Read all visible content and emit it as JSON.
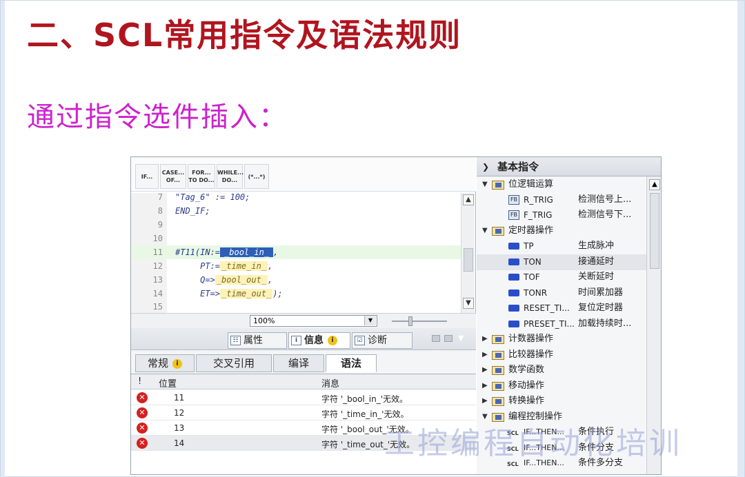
{
  "slide": {
    "title": "二、SCL常用指令及语法规则",
    "subtitle": "通过指令选件插入：",
    "watermark": "工控编程自动化培训"
  },
  "editor": {
    "toolbar": [
      {
        "label": "IF..."
      },
      {
        "label": "CASE...\nOF..."
      },
      {
        "label": "FOR...\nTO DO..."
      },
      {
        "label": "WHILE...\nDO..."
      },
      {
        "label": "(*...*)"
      }
    ],
    "lines": [
      {
        "num": "7",
        "text": "\"Tag_6\" := 100;"
      },
      {
        "num": "8",
        "text": "END_IF;"
      },
      {
        "num": "9",
        "text": ""
      },
      {
        "num": "10",
        "text": ""
      },
      {
        "num": "11",
        "prefix": "#T11(IN:=",
        "param": "_bool_in_",
        "suffix": ","
      },
      {
        "num": "12",
        "prefix": "     PT:=",
        "param": "_time_in_",
        "suffix": ","
      },
      {
        "num": "13",
        "prefix": "     Q=>",
        "param": "_bool_out_",
        "suffix": ","
      },
      {
        "num": "14",
        "prefix": "     ET=>",
        "param": "_time_out_",
        "suffix": ");"
      },
      {
        "num": "15",
        "text": ""
      }
    ],
    "zoom": "100%"
  },
  "info_panel": {
    "top_tabs": [
      {
        "label": "属性",
        "icon": "properties-icon"
      },
      {
        "label": "信息",
        "icon": "info-icon"
      },
      {
        "label": "诊断",
        "icon": "diagnostics-icon"
      }
    ],
    "sub_tabs": [
      "常规",
      "交叉引用",
      "编译",
      "语法"
    ],
    "table_headers": {
      "pos": "位置",
      "msg": "消息"
    },
    "rows": [
      {
        "pos": "11",
        "msg": "字符 '_bool_in_'无效。"
      },
      {
        "pos": "12",
        "msg": "字符 '_time_in_'无效。"
      },
      {
        "pos": "13",
        "msg": "字符 '_bool_out_'无效。"
      },
      {
        "pos": "14",
        "msg": "字符 '_time_out_'无效。"
      }
    ]
  },
  "instructions": {
    "header": "基本指令",
    "items": [
      {
        "label": "位逻辑运算",
        "level": 0,
        "expanded": true,
        "icon": "folder-icon"
      },
      {
        "label": "R_TRIG",
        "desc": "检测信号上...",
        "level": 1,
        "icon": "block-icon"
      },
      {
        "label": "F_TRIG",
        "desc": "检测信号下...",
        "level": 1,
        "icon": "block-icon"
      },
      {
        "label": "定时器操作",
        "level": 0,
        "expanded": true,
        "icon": "folder-icon"
      },
      {
        "label": "TP",
        "desc": "生成脉冲",
        "level": 1,
        "icon": "timer-icon"
      },
      {
        "label": "TON",
        "desc": "接通延时",
        "level": 1,
        "icon": "timer-icon",
        "selected": true
      },
      {
        "label": "TOF",
        "desc": "关断延时",
        "level": 1,
        "icon": "timer-icon"
      },
      {
        "label": "TONR",
        "desc": "时间累加器",
        "level": 1,
        "icon": "timer-icon"
      },
      {
        "label": "RESET_TI...",
        "desc": "复位定时器",
        "level": 1,
        "icon": "timer-icon"
      },
      {
        "label": "PRESET_TI...",
        "desc": "加载持续时...",
        "level": 1,
        "icon": "timer-icon"
      },
      {
        "label": "计数器操作",
        "level": 0,
        "expanded": false,
        "icon": "folder-icon"
      },
      {
        "label": "比较器操作",
        "level": 0,
        "expanded": false,
        "icon": "folder-icon"
      },
      {
        "label": "数学函数",
        "level": 0,
        "expanded": false,
        "icon": "folder-icon"
      },
      {
        "label": "移动操作",
        "level": 0,
        "expanded": false,
        "icon": "folder-icon"
      },
      {
        "label": "转换操作",
        "level": 0,
        "expanded": false,
        "icon": "folder-icon"
      },
      {
        "label": "编程控制操作",
        "level": 0,
        "expanded": true,
        "icon": "folder-icon"
      },
      {
        "label": "IF...THEN...",
        "desc": "条件执行",
        "level": 1,
        "icon": "scl-icon"
      },
      {
        "label": "IF...THEN...",
        "desc": "条件分支",
        "level": 1,
        "icon": "scl-icon"
      },
      {
        "label": "IF...THEN...",
        "desc": "条件多分支",
        "level": 1,
        "icon": "scl-icon"
      }
    ]
  },
  "colors": {
    "title": "#b0151f",
    "subtitle": "#cc22cc",
    "selection": "#2c5fb8",
    "error": "#d42020"
  }
}
